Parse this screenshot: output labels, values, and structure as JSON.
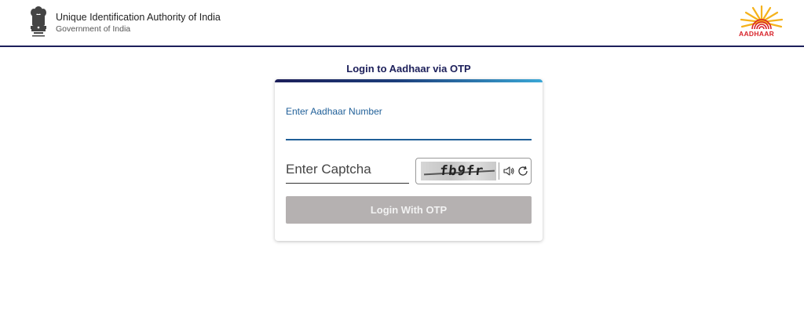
{
  "header": {
    "org_name": "Unique Identification Authority of India",
    "org_sub": "Government of India",
    "aadhaar_logo_text": "AADHAAR",
    "border_color": "#1c1f5a"
  },
  "main": {
    "title": "Login to Aadhaar via OTP"
  },
  "form": {
    "aadhaar_label": "Enter Aadhaar Number",
    "aadhaar_value": "",
    "captcha_placeholder": "Enter Captcha",
    "captcha_value": "",
    "captcha_image_text": "fb9fr",
    "audio_icon": "speaker-icon",
    "refresh_icon": "refresh-icon",
    "login_button": "Login With OTP"
  },
  "colors": {
    "primary": "#1c1f5a",
    "label_blue": "#1f5f98",
    "button_disabled": "#b5b1b1",
    "aadhaar_red": "#d8232a",
    "aadhaar_yellow": "#f5b21b"
  }
}
